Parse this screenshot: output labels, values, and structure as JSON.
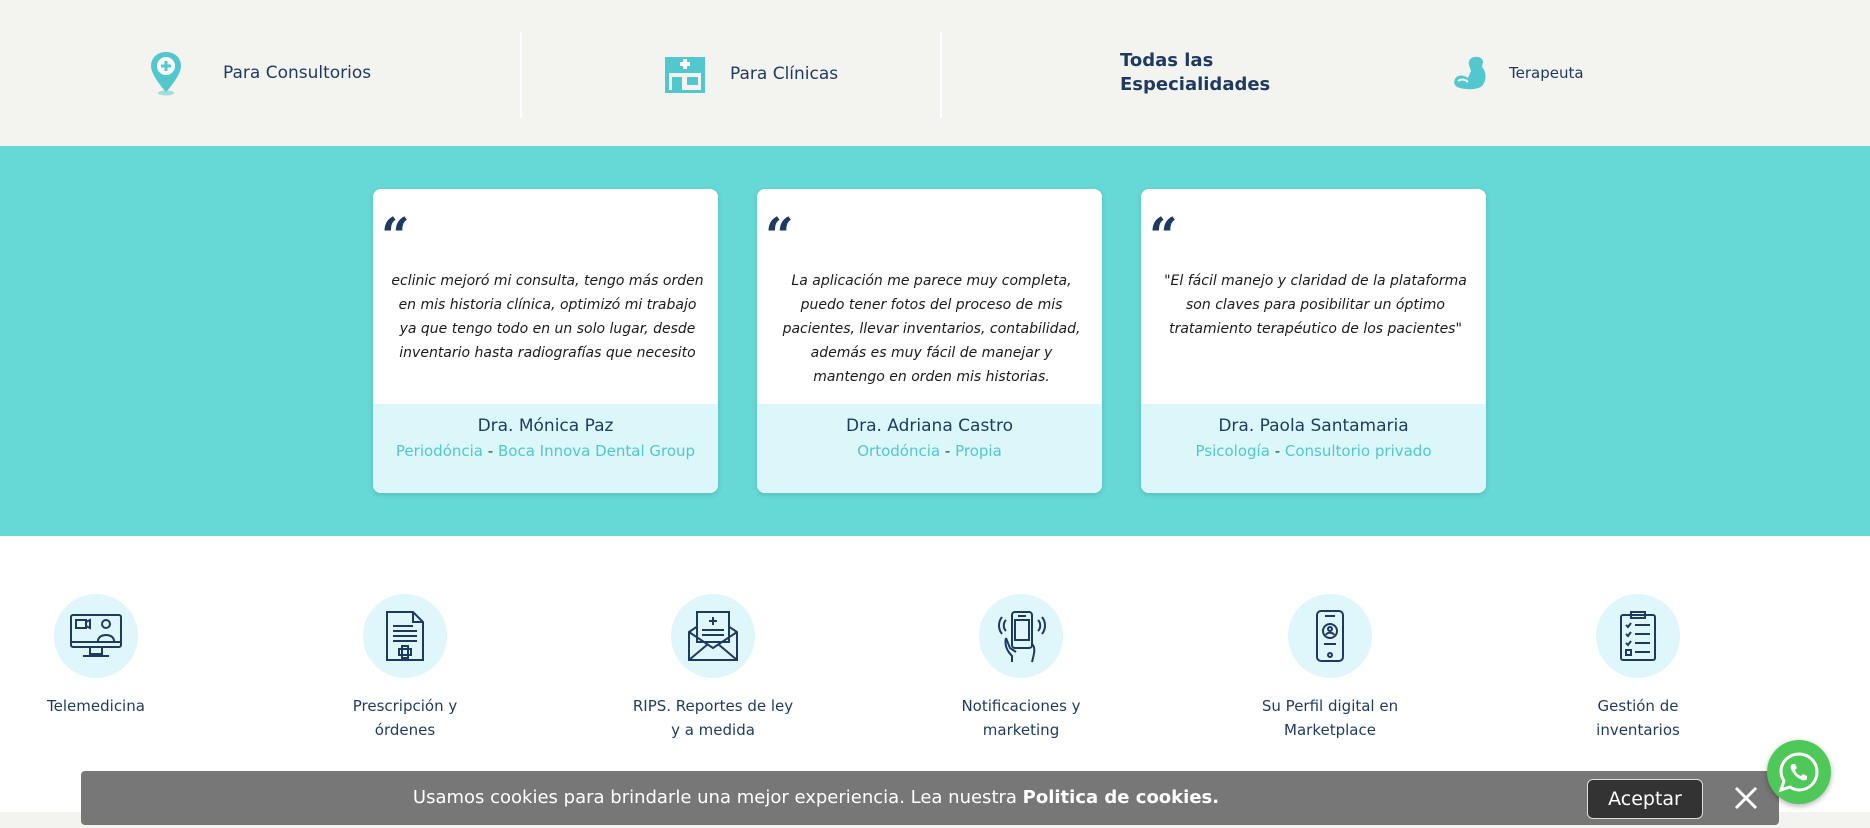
{
  "nav": {
    "consultorios": {
      "label": "Para Consultorios",
      "icon": "location-pin-icon"
    },
    "clinicas": {
      "label": "Para Clínicas",
      "icon": "clinic-building-icon"
    },
    "especialidades": {
      "line1": "Todas las",
      "line2": "Especialidades"
    },
    "terapeuta": {
      "label": "Terapeuta",
      "icon": "flexed-arm-icon"
    }
  },
  "testimonials": [
    {
      "quote": "eclinic mejoró mi consulta, tengo más orden en mis historia clínica, optimizó mi trabajo ya que tengo todo en un solo lugar, desde inventario hasta radiografías que necesito",
      "name": "Dra. Mónica Paz",
      "specialty": "Periodóncia",
      "place": "Boca Innova Dental Group"
    },
    {
      "quote": "La aplicación me parece muy completa, puedo tener fotos del proceso de mis pacientes, llevar inventarios, contabilidad, además es muy fácil de manejar y mantengo en orden mis historias.",
      "name": "Dra. Adriana Castro",
      "specialty": "Ortodóncia",
      "place": "Propia"
    },
    {
      "quote": "\"El fácil manejo y claridad de la plataforma son claves para posibilitar un óptimo tratamiento terapéutico de los pacientes\"",
      "name": "Dra. Paola Santamaria",
      "specialty": "Psicología",
      "place": "Consultorio privado"
    }
  ],
  "quote_mark": "“",
  "dash": "-",
  "features": [
    {
      "line1": "Telemedicina",
      "line2": "",
      "icon": "telemedicine-monitor-icon"
    },
    {
      "line1": "Prescripción y",
      "line2": "órdenes",
      "icon": "prescription-document-icon"
    },
    {
      "line1": "RIPS. Reportes de ley",
      "line2": "y a medida",
      "icon": "report-envelope-icon"
    },
    {
      "line1": "Notificaciones y",
      "line2": "marketing",
      "icon": "phone-notification-icon"
    },
    {
      "line1": "Su Perfil digital en",
      "line2": "Marketplace",
      "icon": "digital-profile-phone-icon"
    },
    {
      "line1": "Gestión de",
      "line2": "inventarios",
      "icon": "inventory-checklist-icon"
    }
  ],
  "cookie": {
    "text": "Usamos cookies para brindarle una mejor experiencia. Lea nuestra ",
    "link": "Politica de cookies.",
    "accept": "Aceptar"
  },
  "colors": {
    "teal_band": "#66d8d6",
    "navy": "#1f3a5f",
    "accent_teal": "#52c7cd",
    "card_footer": "#dcf7f9",
    "cookie_bg": "#777777",
    "whatsapp_green": "#4fc85a"
  }
}
